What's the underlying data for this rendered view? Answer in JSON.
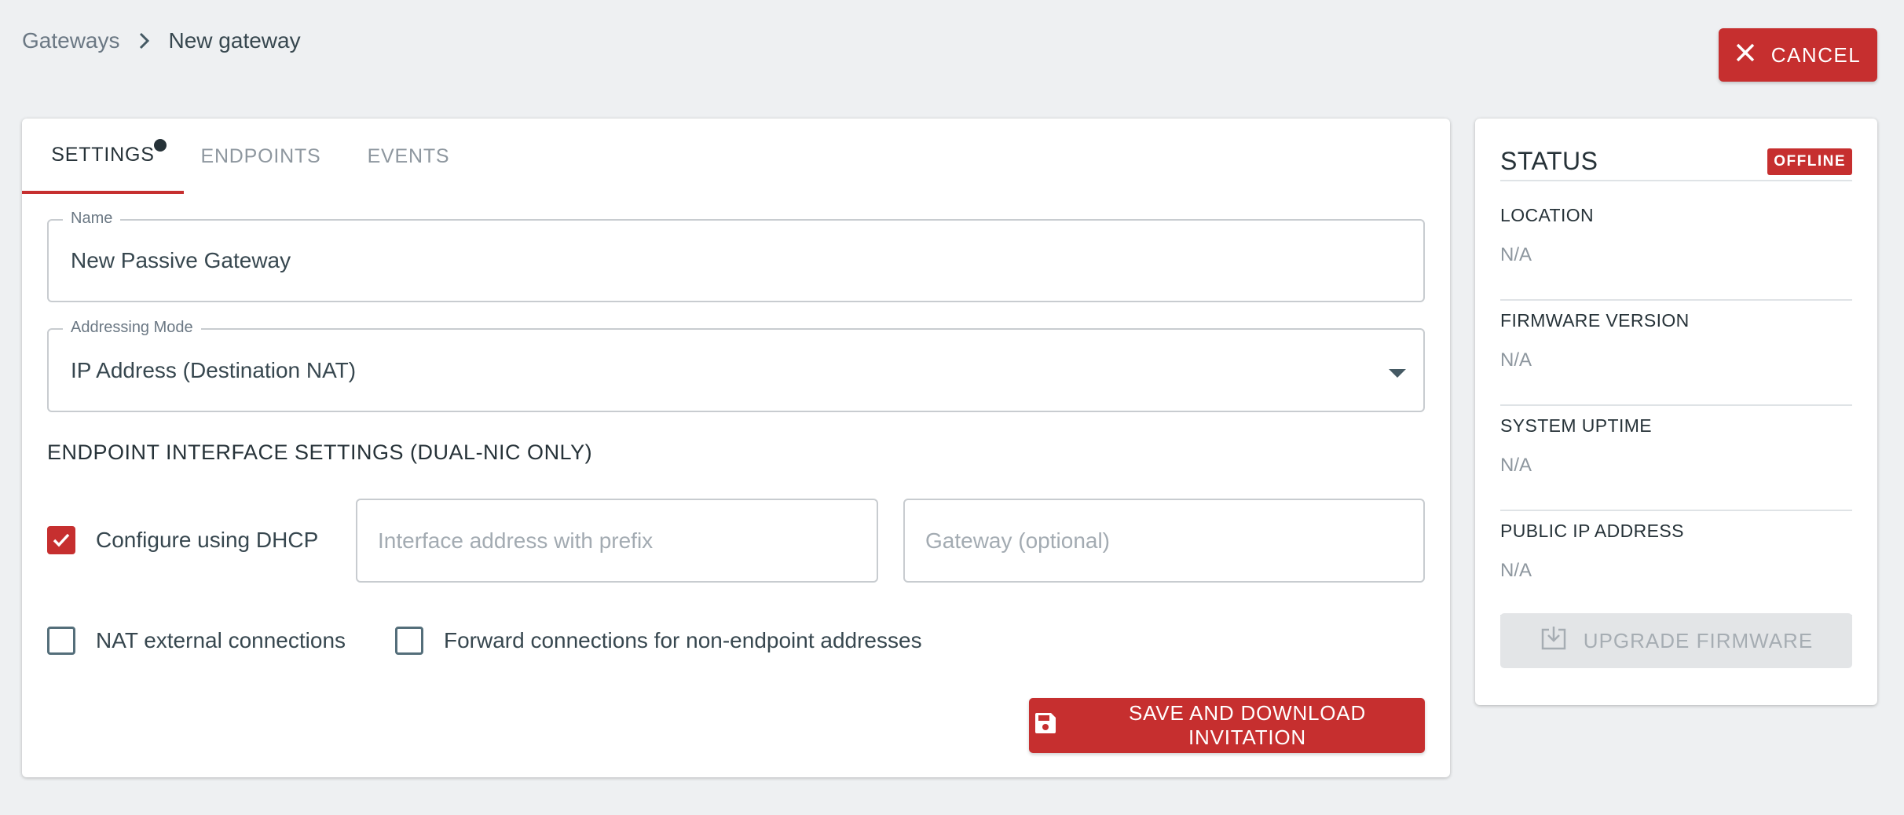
{
  "breadcrumb": {
    "parent": "Gateways",
    "current": "New gateway"
  },
  "header": {
    "cancel_label": "CANCEL"
  },
  "tabs": [
    {
      "label": "SETTINGS",
      "active": true,
      "modified": true
    },
    {
      "label": "ENDPOINTS",
      "active": false
    },
    {
      "label": "EVENTS",
      "active": false
    }
  ],
  "form": {
    "name": {
      "label": "Name",
      "value": "New Passive Gateway"
    },
    "addressing_mode": {
      "label": "Addressing Mode",
      "value": "IP Address (Destination NAT)"
    },
    "section_title": "ENDPOINT INTERFACE SETTINGS (DUAL-NIC ONLY)",
    "dhcp": {
      "label": "Configure using DHCP",
      "checked": true
    },
    "interface_address": {
      "placeholder": "Interface address with prefix",
      "value": ""
    },
    "gateway": {
      "placeholder": "Gateway (optional)",
      "value": ""
    },
    "nat_external": {
      "label": "NAT external connections",
      "checked": false
    },
    "forward_non_endpoint": {
      "label": "Forward connections for non-endpoint addresses",
      "checked": false
    },
    "save_label": "SAVE AND DOWNLOAD INVITATION"
  },
  "status": {
    "title": "STATUS",
    "badge": "OFFLINE",
    "items": [
      {
        "label": "LOCATION",
        "value": "N/A"
      },
      {
        "label": "FIRMWARE VERSION",
        "value": "N/A"
      },
      {
        "label": "SYSTEM UPTIME",
        "value": "N/A"
      },
      {
        "label": "PUBLIC IP ADDRESS",
        "value": "N/A"
      }
    ],
    "upgrade_label": "UPGRADE FIRMWARE"
  },
  "colors": {
    "accent": "#c62f2f",
    "background": "#eef0f2"
  }
}
